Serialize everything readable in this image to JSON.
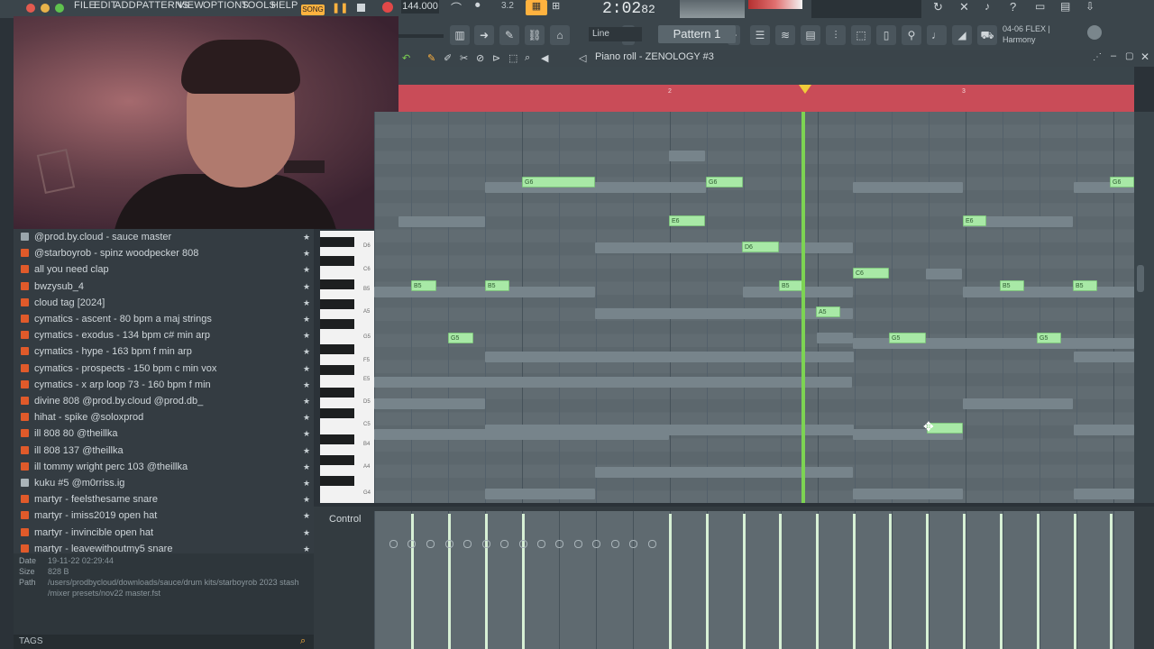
{
  "menu": [
    "FILE",
    "EDIT",
    "ADD",
    "PATTERNS",
    "VIEW",
    "OPTIONS",
    "TOOLS",
    "HELP"
  ],
  "transport": {
    "mode": "SONG",
    "tempo": "144.000",
    "time": "2:02",
    "time_sub": "82"
  },
  "toolbar": {
    "snap": "Line",
    "pattern": "Pattern 1",
    "plugin_line1": "04-06  FLEX |",
    "plugin_line2": "Harmony"
  },
  "piano_roll": {
    "title": "Piano roll - ZENOLOGY #3",
    "bar2": "2",
    "bar3": "3"
  },
  "browser": {
    "items": [
      {
        "label": "@prod.by.cloud - sauce master",
        "icon": "gear-icon"
      },
      {
        "label": "@starboyrob - spinz woodpecker 808",
        "icon": "audio-file-icon"
      },
      {
        "label": "all you need clap",
        "icon": "audio-file-icon"
      },
      {
        "label": "bwzysub_4",
        "icon": "audio-file-icon"
      },
      {
        "label": "cloud tag [2024]",
        "icon": "audio-file-icon"
      },
      {
        "label": "cymatics - ascent - 80 bpm a maj strings",
        "icon": "audio-file-icon"
      },
      {
        "label": "cymatics - exodus - 134 bpm c# min arp",
        "icon": "audio-file-icon"
      },
      {
        "label": "cymatics - hype - 163 bpm f min arp",
        "icon": "audio-file-icon"
      },
      {
        "label": "cymatics - prospects - 150 bpm c min vox",
        "icon": "audio-file-icon"
      },
      {
        "label": "cymatics - x arp loop 73 - 160 bpm f min",
        "icon": "audio-file-icon"
      },
      {
        "label": "divine 808 @prod.by.cloud @prod.db_",
        "icon": "audio-file-icon"
      },
      {
        "label": "hihat - spike @soloxprod",
        "icon": "audio-file-icon"
      },
      {
        "label": "ill 808 80 @theillka",
        "icon": "audio-file-icon"
      },
      {
        "label": "ill 808 137 @theillka",
        "icon": "audio-file-icon"
      },
      {
        "label": "ill tommy wright perc 103 @theillka",
        "icon": "audio-file-icon"
      },
      {
        "label": "kuku #5 @m0rriss.ig",
        "icon": "preset-icon"
      },
      {
        "label": "martyr - feelsthesame snare",
        "icon": "audio-file-icon"
      },
      {
        "label": "martyr - imiss2019 open hat",
        "icon": "audio-file-icon"
      },
      {
        "label": "martyr - invincible open hat",
        "icon": "audio-file-icon"
      },
      {
        "label": "martyr - leavewithoutmy5 snare",
        "icon": "audio-file-icon"
      }
    ],
    "info": {
      "date_label": "Date",
      "date": "19-11-22 02:29:44",
      "size_label": "Size",
      "size": "828 B",
      "path_label": "Path",
      "path1": "/users/prodbycloud/downloads/sauce/drum kits/starboyrob 2023 stash",
      "path2": "/mixer presets/nov22 master.fst"
    },
    "tags_label": "TAGS"
  },
  "keys": [
    "D6",
    "C6",
    "B5",
    "A5",
    "G5",
    "F5",
    "E5",
    "D5",
    "C5",
    "B4",
    "A4",
    "G4"
  ],
  "notes": [
    {
      "name": "G6"
    },
    {
      "name": "G6"
    },
    {
      "name": "G6"
    },
    {
      "name": "E6"
    },
    {
      "name": "E6"
    },
    {
      "name": "D6"
    },
    {
      "name": "C6"
    },
    {
      "name": "B5"
    },
    {
      "name": "B5"
    },
    {
      "name": "B5"
    },
    {
      "name": "B5"
    },
    {
      "name": "B5"
    },
    {
      "name": "A5"
    },
    {
      "name": "G5"
    },
    {
      "name": "G5"
    },
    {
      "name": "G5"
    },
    {
      "name": ""
    }
  ],
  "control": {
    "label": "Control"
  }
}
